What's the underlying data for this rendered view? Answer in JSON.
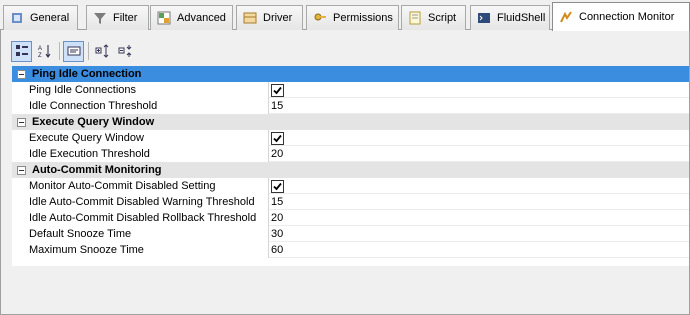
{
  "tabs": [
    {
      "label": "General",
      "icon": "wrench-icon"
    },
    {
      "label": "Filter",
      "icon": "filter-icon"
    },
    {
      "label": "Advanced",
      "icon": "grid-icon"
    },
    {
      "label": "Driver",
      "icon": "driver-icon"
    },
    {
      "label": "Permissions",
      "icon": "key-icon"
    },
    {
      "label": "Script",
      "icon": "script-icon"
    },
    {
      "label": "FluidShell",
      "icon": "terminal-icon"
    },
    {
      "label": "Connection Monitor",
      "icon": "monitor-icon"
    }
  ],
  "active_tab": "Connection Monitor",
  "toolbar": {
    "buttons": [
      "categorized-view",
      "sort-alphabetical",
      "show-description",
      "expand-all",
      "collapse-all"
    ]
  },
  "categories": [
    {
      "title": "Ping Idle Connection",
      "selected": true,
      "properties": [
        {
          "name": "Ping Idle Connections",
          "type": "checkbox",
          "checked": true
        },
        {
          "name": "Idle Connection Threshold",
          "type": "text",
          "value": "15"
        }
      ]
    },
    {
      "title": "Execute Query Window",
      "selected": false,
      "properties": [
        {
          "name": "Execute Query Window",
          "type": "checkbox",
          "checked": true
        },
        {
          "name": "Idle Execution Threshold",
          "type": "text",
          "value": "20"
        }
      ]
    },
    {
      "title": "Auto-Commit Monitoring",
      "selected": false,
      "properties": [
        {
          "name": "Monitor Auto-Commit Disabled Setting",
          "type": "checkbox",
          "checked": true
        },
        {
          "name": "Idle Auto-Commit Disabled Warning Threshold",
          "type": "text",
          "value": "15"
        },
        {
          "name": "Idle Auto-Commit Disabled Rollback Threshold",
          "type": "text",
          "value": "20"
        },
        {
          "name": "Default Snooze Time",
          "type": "text",
          "value": "30"
        },
        {
          "name": "Maximum Snooze Time",
          "type": "text",
          "value": "60"
        }
      ]
    }
  ],
  "colors": {
    "selected_category": "#3b8de0",
    "category_bg": "#e4e4e4"
  }
}
